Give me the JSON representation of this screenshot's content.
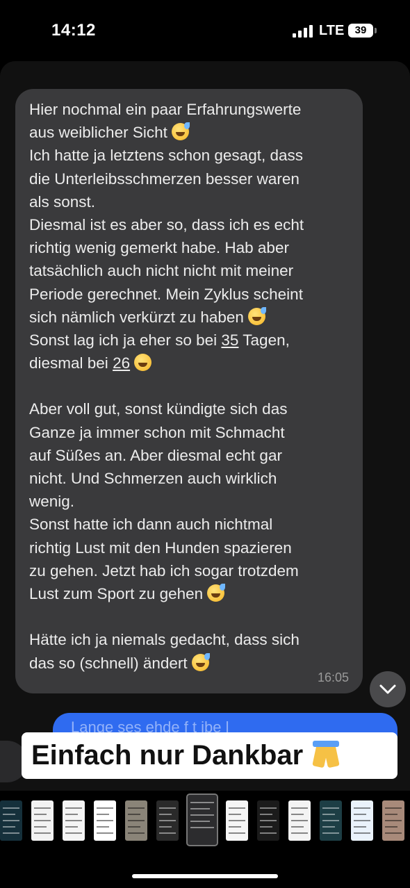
{
  "status_bar": {
    "time": "14:12",
    "network": "LTE",
    "battery": "39"
  },
  "message": {
    "lines": [
      {
        "text": "Hier nochmal ein paar Erfahrungswerte"
      },
      {
        "text": "aus weiblicher Sicht",
        "emoji": "grinning-sweat"
      },
      {
        "text": "Ich hatte ja letztens schon gesagt, dass"
      },
      {
        "text": "die Unterleibsschmerzen besser waren"
      },
      {
        "text": "als sonst."
      },
      {
        "text": "Diesmal ist es aber so, dass ich es echt"
      },
      {
        "text": "richtig wenig gemerkt habe. Hab aber"
      },
      {
        "text": "tatsächlich auch nicht nicht mit meiner"
      },
      {
        "text": "Periode gerechnet. Mein Zyklus scheint"
      },
      {
        "text": "sich nämlich verkürzt zu haben",
        "emoji": "grinning-sweat"
      },
      {
        "text": "Sonst lag ich ja eher so bei ",
        "underlined": "35",
        "after": " Tagen,"
      },
      {
        "text": "diesmal bei ",
        "underlined": "26",
        "emoji": "smiling-blush"
      },
      {
        "text": ""
      },
      {
        "text": "Aber voll gut, sonst kündigte sich das"
      },
      {
        "text": "Ganze ja immer schon mit Schmacht"
      },
      {
        "text": "auf Süßes an. Aber diesmal echt gar"
      },
      {
        "text": "nicht. Und Schmerzen auch wirklich"
      },
      {
        "text": "wenig."
      },
      {
        "text": "Sonst hatte ich dann auch nichtmal"
      },
      {
        "text": "richtig Lust mit den Hunden spazieren"
      },
      {
        "text": "zu gehen. Jetzt hab ich sogar trotzdem"
      },
      {
        "text": "Lust zum Sport zu gehen",
        "emoji": "grinning-sweat"
      },
      {
        "text": ""
      },
      {
        "text": "Hätte ich ja niemals gedacht, dass sich"
      },
      {
        "text": "das so (schnell) ändert",
        "emoji": "grinning-sweat"
      }
    ],
    "timestamp": "16:05"
  },
  "outgoing": {
    "partial_text": "Lange ses ehde f t ibe l"
  },
  "caption": {
    "text": "Einfach nur Dankbar",
    "emoji": "folded-hands"
  },
  "scroll_down": {
    "icon": "chevron-down-icon"
  },
  "thumbnails": [
    {
      "bg": "#15303b",
      "dark": true
    },
    {
      "bg": "#f2f2f2",
      "dark": false
    },
    {
      "bg": "#f4f4f4",
      "dark": false
    },
    {
      "bg": "#ffffff",
      "dark": false
    },
    {
      "bg": "#8a8478",
      "dark": false
    },
    {
      "bg": "#2a2a2a",
      "dark": true
    },
    {
      "bg": "#2c2c2e",
      "dark": true,
      "active": true
    },
    {
      "bg": "#f5f5f5",
      "dark": false
    },
    {
      "bg": "#1b1b1b",
      "dark": true
    },
    {
      "bg": "#f3f3f3",
      "dark": false
    },
    {
      "bg": "#1d3e45",
      "dark": true
    },
    {
      "bg": "#eaf2fb",
      "dark": false
    },
    {
      "bg": "#a88a7a",
      "dark": false
    }
  ],
  "colors": {
    "bubble": "#3a3a3c",
    "outgoing": "#2f6bf0",
    "caption_bg": "#ffffff"
  }
}
